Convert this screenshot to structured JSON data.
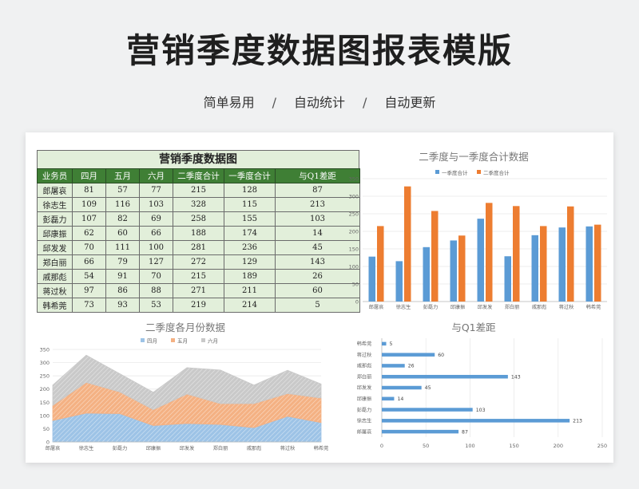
{
  "page": {
    "title": "营销季度数据图报表模版",
    "subtitle_items": [
      "简单易用",
      "自动统计",
      "自动更新"
    ],
    "separator": "/"
  },
  "table": {
    "title": "营销季度数据图",
    "headers": [
      "业务员",
      "四月",
      "五月",
      "六月",
      "二季度合计",
      "一季度合计",
      "与Q1差距"
    ],
    "rows": [
      [
        "郎屠哀",
        "81",
        "57",
        "77",
        "215",
        "128",
        "87"
      ],
      [
        "徐志生",
        "109",
        "116",
        "103",
        "328",
        "115",
        "213"
      ],
      [
        "彭磊力",
        "107",
        "82",
        "69",
        "258",
        "155",
        "103"
      ],
      [
        "邱康振",
        "62",
        "60",
        "66",
        "188",
        "174",
        "14"
      ],
      [
        "邱发发",
        "70",
        "111",
        "100",
        "281",
        "236",
        "45"
      ],
      [
        "郑白丽",
        "66",
        "79",
        "127",
        "272",
        "129",
        "143"
      ],
      [
        "戚那彪",
        "54",
        "91",
        "70",
        "215",
        "189",
        "26"
      ],
      [
        "蒋过秋",
        "97",
        "86",
        "88",
        "271",
        "211",
        "60"
      ],
      [
        "韩希莞",
        "73",
        "93",
        "53",
        "219",
        "214",
        "5"
      ]
    ]
  },
  "chart_data": [
    {
      "type": "bar",
      "title": "二季度与一季度合计数据",
      "categories": [
        "郎屠哀",
        "徐志生",
        "彭磊力",
        "邱康振",
        "邱发发",
        "郑白丽",
        "戚那彪",
        "蒋过秋",
        "韩希莞"
      ],
      "series": [
        {
          "name": "一季度合计",
          "values": [
            128,
            115,
            155,
            174,
            236,
            129,
            189,
            211,
            214
          ],
          "color": "#5b9bd5"
        },
        {
          "name": "二季度合计",
          "values": [
            215,
            328,
            258,
            188,
            281,
            272,
            215,
            271,
            219
          ],
          "color": "#ed7d31"
        }
      ],
      "ylim": [
        0,
        350
      ],
      "yticks": [
        0,
        50,
        100,
        150,
        200,
        250,
        300,
        350
      ],
      "legend": "top"
    },
    {
      "type": "area",
      "stacked": true,
      "title": "二季度各月份数据",
      "categories": [
        "郎屠哀",
        "徐志生",
        "彭磊力",
        "邱康振",
        "邱发发",
        "郑白丽",
        "戚那彪",
        "蒋过秋",
        "韩希莞"
      ],
      "series": [
        {
          "name": "四月",
          "values": [
            81,
            109,
            107,
            62,
            70,
            66,
            54,
            97,
            73
          ],
          "color": "#9dc3e6"
        },
        {
          "name": "五月",
          "values": [
            57,
            116,
            82,
            60,
            111,
            79,
            91,
            86,
            93
          ],
          "color": "#f4b183"
        },
        {
          "name": "六月",
          "values": [
            77,
            103,
            69,
            66,
            100,
            127,
            70,
            88,
            53
          ],
          "color": "#c9c9c9"
        }
      ],
      "ylim": [
        0,
        350
      ],
      "yticks": [
        0,
        50,
        100,
        150,
        200,
        250,
        300,
        350
      ],
      "legend": "top"
    },
    {
      "type": "bar",
      "orientation": "horizontal",
      "title": "与Q1差距",
      "categories": [
        "韩希莞",
        "蒋过秋",
        "戚那彪",
        "郑白丽",
        "邱发发",
        "邱康振",
        "彭磊力",
        "徐志生",
        "郎屠哀"
      ],
      "values": [
        5,
        60,
        26,
        143,
        45,
        14,
        103,
        213,
        87
      ],
      "color": "#5b9bd5",
      "xlim": [
        0,
        250
      ],
      "xticks": [
        0,
        50,
        100,
        150,
        200,
        250
      ]
    }
  ]
}
